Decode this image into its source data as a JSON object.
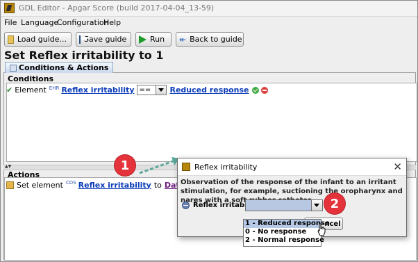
{
  "window": {
    "title": "GDL Editor - Apgar Score (build 2017-04-04_13-59)"
  },
  "menu": [
    "File",
    "Language",
    "Configuration",
    "Help"
  ],
  "toolbar": {
    "load": "Load guide...",
    "save": "Save guide",
    "run": "Run",
    "back": "Back to guide"
  },
  "page_title": "Set Reflex irritability to 1",
  "tab": "Conditions & Actions",
  "conditions": {
    "label": "Conditions",
    "row": {
      "prefix": "Element",
      "tag": "EHR",
      "element": "Reflex irritability",
      "operator": "==",
      "value": "Reduced response"
    }
  },
  "actions": {
    "label": "Actions",
    "row": {
      "prefix": "Set element",
      "tag": "CDS",
      "element": "Reflex irritability",
      "to": "to",
      "value": "DataValue"
    }
  },
  "annotations": {
    "badge1": "1",
    "badge2": "2"
  },
  "dialog": {
    "title": "Reflex irritability",
    "description": "Observation of the response of the infant to an irritant stimulation, for example, suctioning the oropharynx and nares with a soft rubber catheter.",
    "field_label": "Reflex irritability:",
    "cancel_button_visible": "ncel",
    "options": [
      "1 - Reduced response",
      "0 - No response",
      "2 - Normal response"
    ],
    "highlighted_option": "1 - Reduced response"
  }
}
